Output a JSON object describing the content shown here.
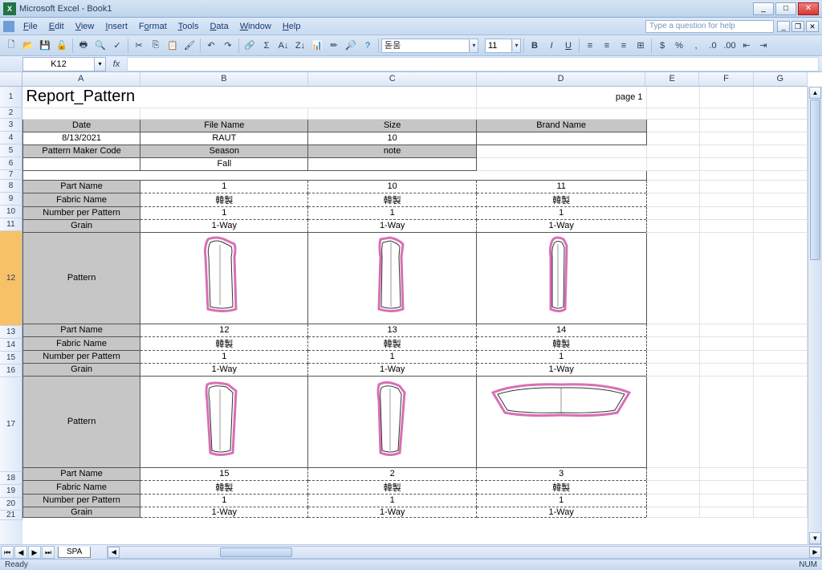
{
  "window": {
    "title": "Microsoft Excel - Book1"
  },
  "menu": {
    "items": [
      "File",
      "Edit",
      "View",
      "Insert",
      "Format",
      "Tools",
      "Data",
      "Window",
      "Help"
    ],
    "helpPlaceholder": "Type a question for help"
  },
  "toolbar": {
    "font": "돋움",
    "size": "11"
  },
  "namebox": "K12",
  "cols": [
    "A",
    "B",
    "C",
    "D",
    "E",
    "F",
    "G"
  ],
  "rows": [
    "1",
    "2",
    "3",
    "4",
    "5",
    "6",
    "7",
    "8",
    "9",
    "10",
    "11",
    "12",
    "13",
    "14",
    "15",
    "16",
    "17",
    "18",
    "19",
    "20",
    "21"
  ],
  "sheet": {
    "title": "Report_Pattern",
    "page": "page 1",
    "headers1": {
      "A": "Date",
      "B": "File Name",
      "C": "Size",
      "D": "Brand Name"
    },
    "row4": {
      "A": "8/13/2021",
      "B": "RAUT",
      "C": "10",
      "D": ""
    },
    "headers2": {
      "A": "Pattern Maker Code",
      "B": "Season",
      "C": "note"
    },
    "row6": {
      "A": "",
      "B": "Fall",
      "C": ""
    },
    "labels": {
      "partName": "Part Name",
      "fabricName": "Fabric Name",
      "numPerPattern": "Number per Pattern",
      "grain": "Grain",
      "pattern": "Pattern"
    },
    "block1": {
      "partB": "1",
      "partC": "10",
      "partD": "11",
      "fabB": "韓製",
      "fabC": "韓製",
      "fabD": "韓製",
      "numB": "1",
      "numC": "1",
      "numD": "1",
      "grB": "1-Way",
      "grC": "1-Way",
      "grD": "1-Way"
    },
    "block2": {
      "partB": "12",
      "partC": "13",
      "partD": "14",
      "fabB": "韓製",
      "fabC": "韓製",
      "fabD": "韓製",
      "numB": "1",
      "numC": "1",
      "numD": "1",
      "grB": "1-Way",
      "grC": "1-Way",
      "grD": "1-Way"
    },
    "block3": {
      "partB": "15",
      "partC": "2",
      "partD": "3",
      "fabB": "韓製",
      "fabC": "韓製",
      "fabD": "韓製",
      "numB": "1",
      "numC": "1",
      "numD": "1",
      "grB": "1-Way",
      "grC": "1-Way",
      "grD": "1-Way"
    }
  },
  "tab": "SPA",
  "status": {
    "left": "Ready",
    "right": "NUM"
  }
}
